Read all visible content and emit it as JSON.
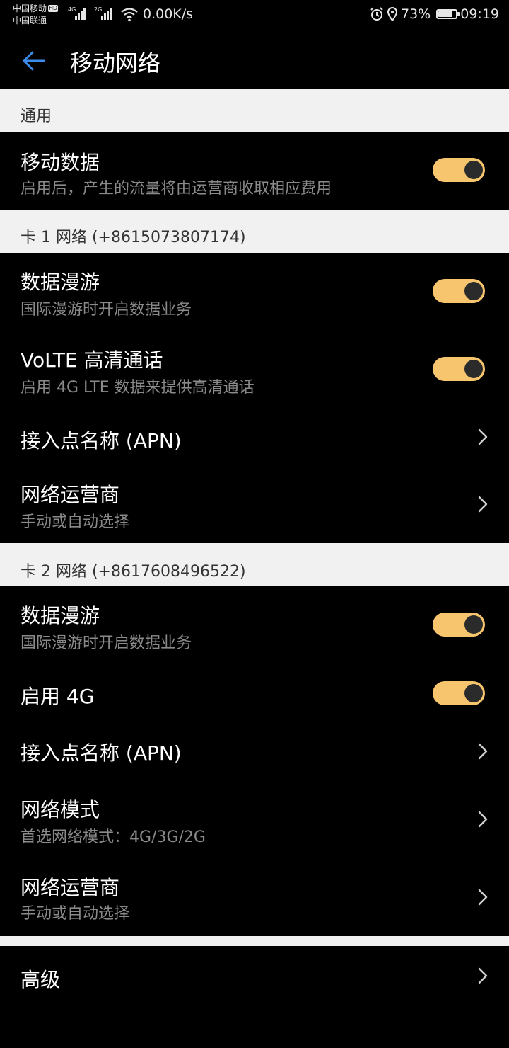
{
  "status_bar": {
    "carrier1": "中国移动",
    "hd_badge": "HD",
    "carrier2": "中国联通",
    "sig1_tag": "4G",
    "sig2_tag": "2G",
    "speed": "0.00K/s",
    "battery": "73%",
    "time": "09:19"
  },
  "app_bar": {
    "title": "移动网络"
  },
  "sections": {
    "general": {
      "label": "通用"
    },
    "mobile_data": {
      "title": "移动数据",
      "subtitle": "启用后，产生的流量将由运营商收取相应费用",
      "on": true
    },
    "sim1": {
      "label": "卡 1 网络 (+8615073807174)",
      "data_roaming": {
        "title": "数据漫游",
        "subtitle": "国际漫游时开启数据业务",
        "on": true
      },
      "volte": {
        "title": "VoLTE 高清通话",
        "subtitle": "启用 4G LTE 数据来提供高清通话",
        "on": true
      },
      "apn": {
        "title": "接入点名称 (APN)"
      },
      "operator": {
        "title": "网络运营商",
        "subtitle": "手动或自动选择"
      }
    },
    "sim2": {
      "label": "卡 2 网络 (+8617608496522)",
      "data_roaming": {
        "title": "数据漫游",
        "subtitle": "国际漫游时开启数据业务",
        "on": true
      },
      "enable_4g": {
        "title": "启用 4G",
        "on": true
      },
      "apn": {
        "title": "接入点名称 (APN)"
      },
      "network_mode": {
        "title": "网络模式",
        "subtitle": "首选网络模式：4G/3G/2G"
      },
      "operator": {
        "title": "网络运营商",
        "subtitle": "手动或自动选择"
      }
    },
    "advanced": {
      "title": "高级"
    }
  },
  "colors": {
    "toggle_on": "#f7c56d",
    "accent": "#3b8beb",
    "band": "#f1f1f1"
  }
}
